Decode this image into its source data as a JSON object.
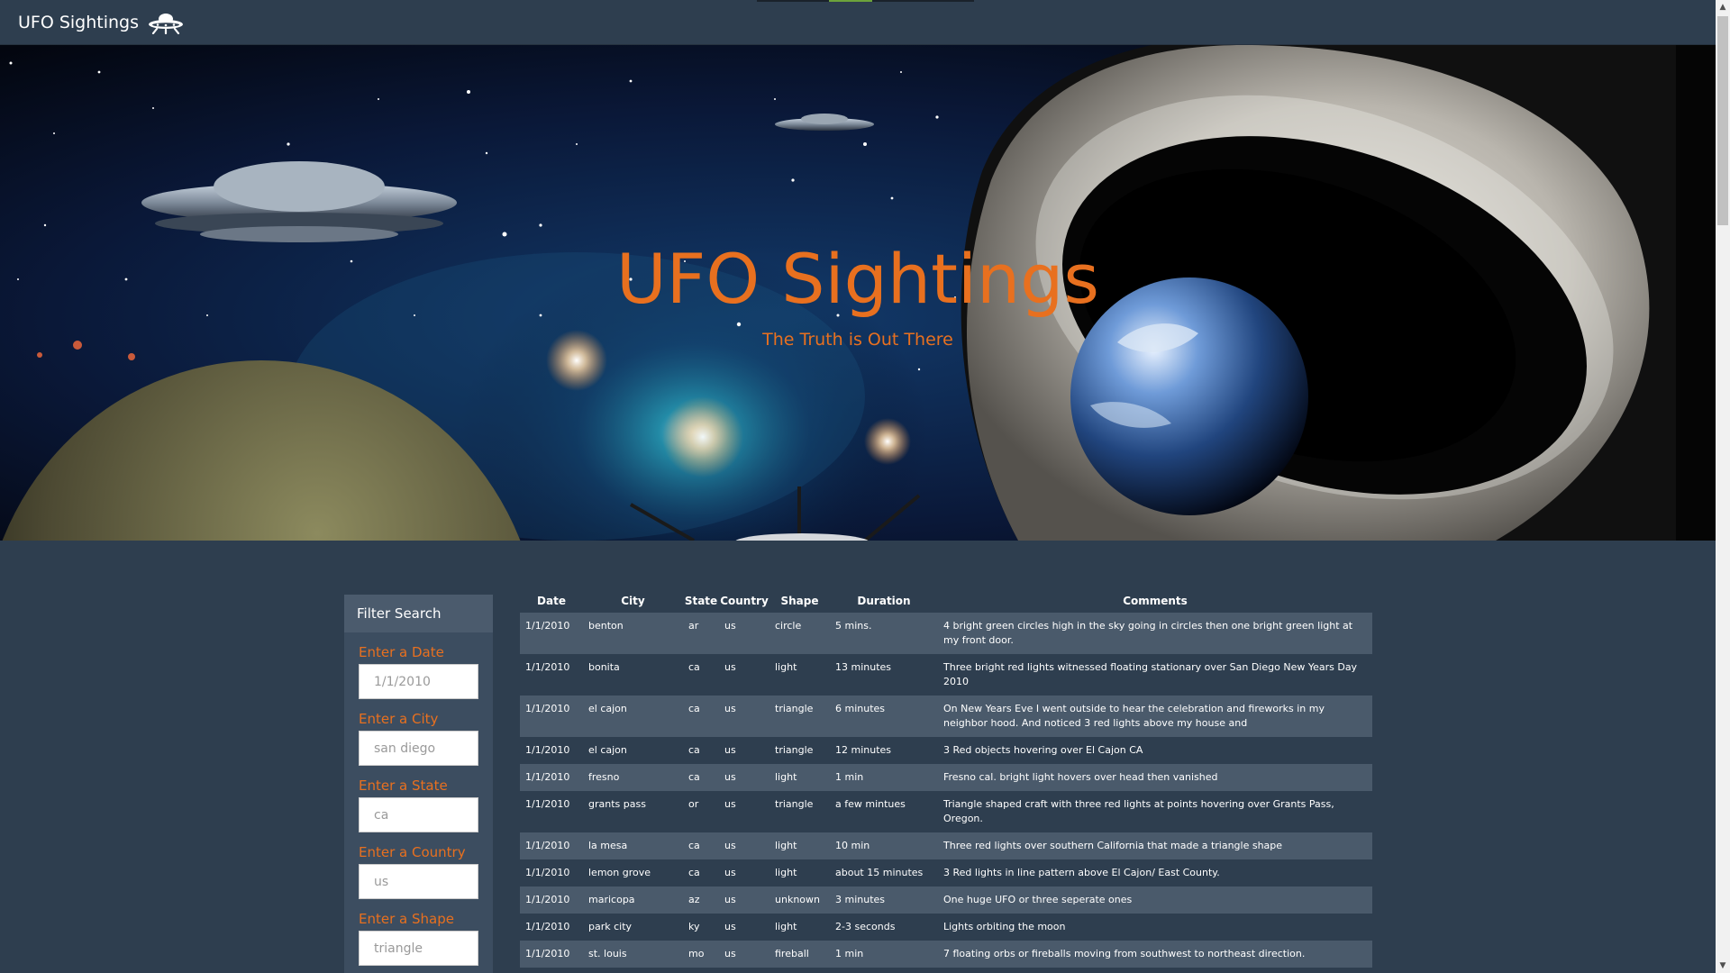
{
  "navbar": {
    "brand": "UFO Sightings",
    "brand_icon": "ufo-icon",
    "progress": 0.2
  },
  "hero": {
    "title": "UFO Sightings",
    "subtitle": "The Truth is Out There"
  },
  "filter": {
    "heading": "Filter Search",
    "fields": [
      {
        "label": "Enter a Date",
        "placeholder": "1/1/2010"
      },
      {
        "label": "Enter a City",
        "placeholder": "san diego"
      },
      {
        "label": "Enter a State",
        "placeholder": "ca"
      },
      {
        "label": "Enter a Country",
        "placeholder": "us"
      },
      {
        "label": "Enter a Shape",
        "placeholder": "triangle"
      }
    ]
  },
  "table": {
    "headers": [
      "Date",
      "City",
      "State",
      "Country",
      "Shape",
      "Duration",
      "Comments"
    ],
    "rows": [
      [
        "1/1/2010",
        "benton",
        "ar",
        "us",
        "circle",
        "5 mins.",
        "4 bright green circles high in the sky going in circles then one bright green light at my front door."
      ],
      [
        "1/1/2010",
        "bonita",
        "ca",
        "us",
        "light",
        "13 minutes",
        "Three bright red lights witnessed floating stationary over San Diego New Years Day 2010"
      ],
      [
        "1/1/2010",
        "el cajon",
        "ca",
        "us",
        "triangle",
        "6 minutes",
        "On New Years Eve I went outside to hear the celebration and fireworks in my neighbor hood. And noticed 3 red lights above my house and"
      ],
      [
        "1/1/2010",
        "el cajon",
        "ca",
        "us",
        "triangle",
        "12 minutes",
        "3 Red objects hovering over El Cajon CA"
      ],
      [
        "1/1/2010",
        "fresno",
        "ca",
        "us",
        "light",
        "1 min",
        "Fresno cal. bright light hovers over head then vanished"
      ],
      [
        "1/1/2010",
        "grants pass",
        "or",
        "us",
        "triangle",
        "a few mintues",
        "Triangle shaped craft with three red lights at points hovering over Grants Pass, Oregon."
      ],
      [
        "1/1/2010",
        "la mesa",
        "ca",
        "us",
        "light",
        "10 min",
        "Three red lights over southern California that made a triangle shape"
      ],
      [
        "1/1/2010",
        "lemon grove",
        "ca",
        "us",
        "light",
        "about 15 minutes",
        "3 Red lights in line pattern above El Cajon/ East County."
      ],
      [
        "1/1/2010",
        "maricopa",
        "az",
        "us",
        "unknown",
        "3 minutes",
        "One huge UFO or three seperate ones"
      ],
      [
        "1/1/2010",
        "park city",
        "ky",
        "us",
        "light",
        "2-3 seconds",
        "Lights orbiting the moon"
      ],
      [
        "1/1/2010",
        "st. louis",
        "mo",
        "us",
        "fireball",
        "1 min",
        "7 floating orbs or fireballs moving from southwest to northeast direction."
      ]
    ]
  },
  "colors": {
    "background": "#2e3e4f",
    "accent": "#e8701f",
    "row_stripe": "#4a5a6b",
    "panel": "#3c4d60"
  }
}
